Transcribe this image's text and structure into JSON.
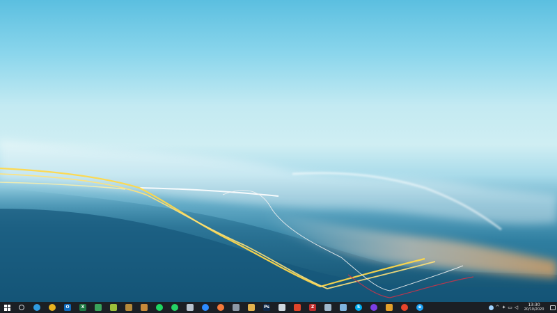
{
  "taskbar": {
    "apps": [
      {
        "name": "search-icon",
        "glyph": "",
        "color": "#1b1f24"
      },
      {
        "name": "edge-icon",
        "glyph": "",
        "color": "#2f9be0"
      },
      {
        "name": "chrome-icon",
        "glyph": "",
        "color": "#e8b21f"
      },
      {
        "name": "outlook-icon",
        "glyph": "O",
        "color": "#0f6cbd"
      },
      {
        "name": "excel-icon",
        "glyph": "X",
        "color": "#1e7a45"
      },
      {
        "name": "sheets-icon",
        "glyph": "",
        "color": "#3aa35b"
      },
      {
        "name": "leaf-icon",
        "glyph": "",
        "color": "#9cbf3a"
      },
      {
        "name": "app-icon",
        "glyph": "",
        "color": "#b58a3b"
      },
      {
        "name": "store-icon",
        "glyph": "",
        "color": "#c78a3a"
      },
      {
        "name": "spotify-icon",
        "glyph": "",
        "color": "#1ed760"
      },
      {
        "name": "whatsapp-icon",
        "glyph": "",
        "color": "#25d366"
      },
      {
        "name": "file-icon",
        "glyph": "",
        "color": "#b9c4cf"
      },
      {
        "name": "zoom-icon",
        "glyph": "",
        "color": "#2d8cff"
      },
      {
        "name": "firefox-icon",
        "glyph": "",
        "color": "#f5793a"
      },
      {
        "name": "calculator-icon",
        "glyph": "",
        "color": "#8d99a6"
      },
      {
        "name": "folder-icon",
        "glyph": "",
        "color": "#e2b24d"
      },
      {
        "name": "photoshop-icon",
        "glyph": "Ps",
        "color": "#0f2a4a"
      },
      {
        "name": "cloud-icon",
        "glyph": "",
        "color": "#cfd8df"
      },
      {
        "name": "red-app-icon",
        "glyph": "",
        "color": "#e0452b"
      },
      {
        "name": "filezilla-icon",
        "glyph": "Z",
        "color": "#bf2d2d"
      },
      {
        "name": "network-icon",
        "glyph": "",
        "color": "#9fb8cc"
      },
      {
        "name": "scanner-icon",
        "glyph": "",
        "color": "#7fb4de"
      },
      {
        "name": "skype-icon",
        "glyph": "S",
        "color": "#00aff0"
      },
      {
        "name": "firefox-alt-icon",
        "glyph": "",
        "color": "#7b3fe4"
      },
      {
        "name": "mixed-icon",
        "glyph": "",
        "color": "#e2a02b"
      },
      {
        "name": "chrome-red-icon",
        "glyph": "",
        "color": "#e8452b"
      },
      {
        "name": "ie-icon",
        "glyph": "e",
        "color": "#1ea1f2"
      }
    ],
    "clock": {
      "time": "13:30",
      "date": "20/10/2020"
    }
  }
}
